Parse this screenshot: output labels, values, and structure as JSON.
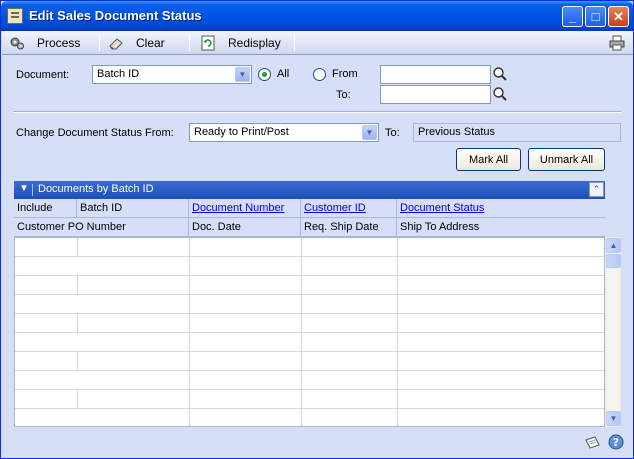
{
  "window": {
    "title": "Edit Sales Document Status"
  },
  "toolbar": {
    "process": "Process",
    "clear": "Clear",
    "redisplay": "Redisplay"
  },
  "filter": {
    "document_label": "Document:",
    "document_value": "Batch ID",
    "all_label": "All",
    "from_label": "From",
    "to_label": "To:",
    "from_value": "",
    "to_value": "",
    "selected_range": "All"
  },
  "status": {
    "change_label": "Change Document Status From:",
    "from_value": "Ready to Print/Post",
    "to_label": "To:",
    "to_value": "Previous Status"
  },
  "buttons": {
    "mark_all": "Mark All",
    "unmark_all": "Unmark All"
  },
  "grid": {
    "title": "Documents by Batch ID",
    "header_row1": [
      "Include",
      "Batch ID",
      "Document Number",
      "Customer ID",
      "Document Status"
    ],
    "header_row2": [
      "Customer PO Number",
      "Doc. Date",
      "Req. Ship Date",
      "Ship To Address"
    ],
    "rows": []
  }
}
